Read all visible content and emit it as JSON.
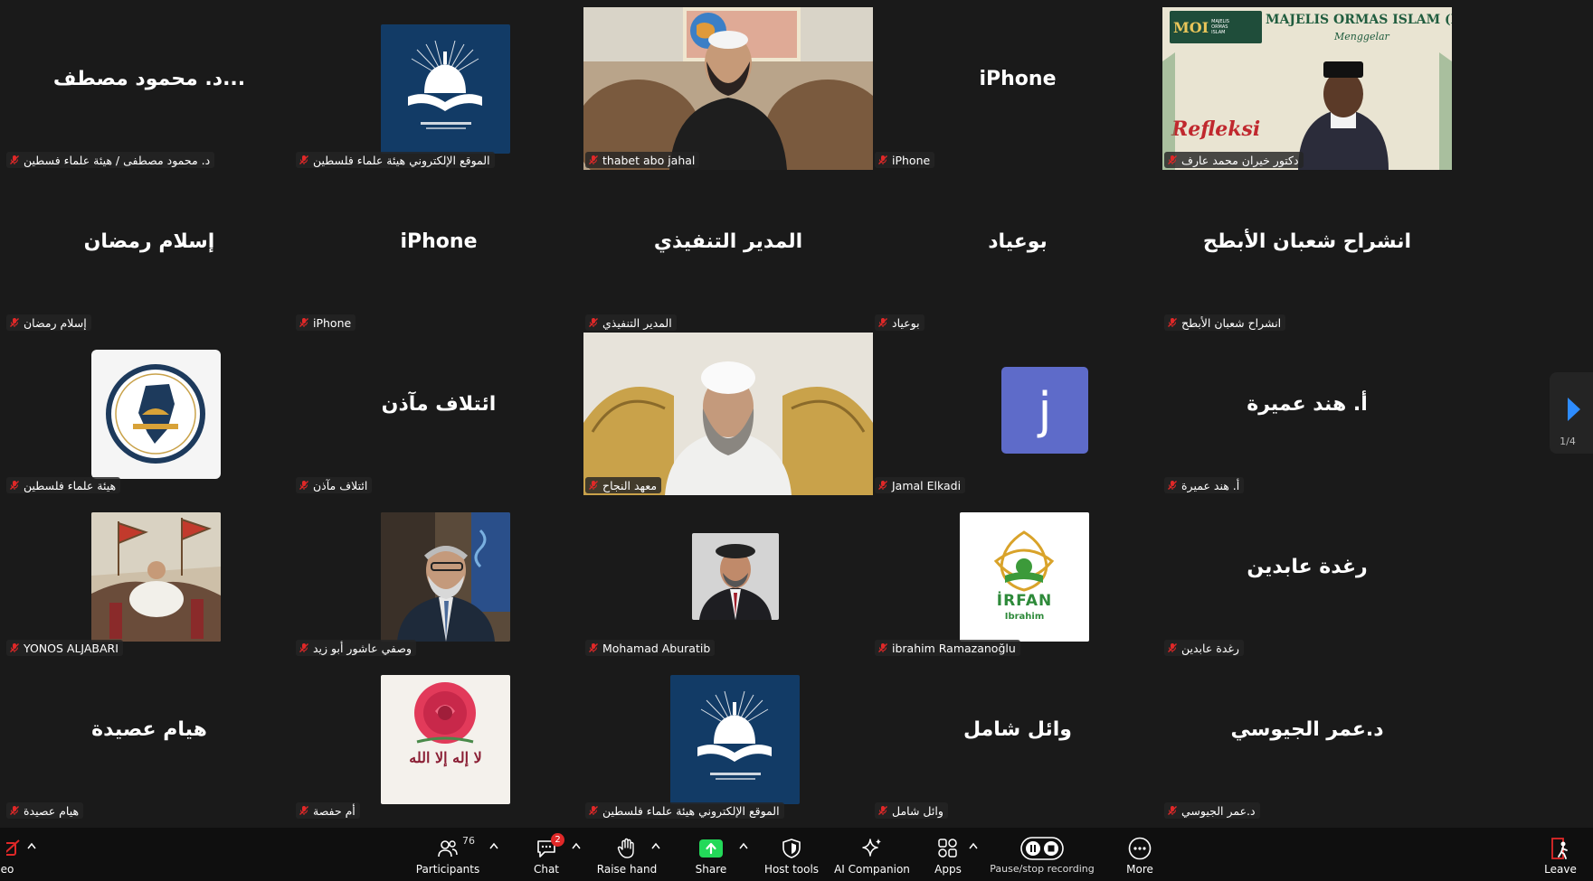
{
  "gallery": {
    "tiles": [
      {
        "big_name": "د. محمود مصطف...",
        "label": "د. محمود مصطفى / هيئة علماء فسطين"
      },
      {
        "label": "الموقع الإلكتروني هيئة علماء فلسطين"
      },
      {
        "label": "thabet abo jahal"
      },
      {
        "big_name": "iPhone",
        "label": "iPhone"
      },
      {
        "label": "دكتور خيران محمد عارف",
        "banner_title": "MAJELIS ORMAS ISLAM (MOI)",
        "banner_sub": "Menggelar",
        "banner_logo": "MOI",
        "banner_logo_sub": "MAJELIS ORMAS ISLAM",
        "banner_script": "Refleksi"
      },
      {
        "big_name": "إسلام رمضان",
        "label": "إسلام رمضان"
      },
      {
        "big_name": "iPhone",
        "label": "iPhone"
      },
      {
        "big_name": "المدير التنفيذي",
        "label": "المدير التنفيذي"
      },
      {
        "big_name": "بوعياد",
        "label": "بوعياد"
      },
      {
        "big_name": "انشراح شعبان الأبطح",
        "label": "انشراح شعبان الأبطح"
      },
      {
        "label": "هيئة علماء فلسطين"
      },
      {
        "big_name": "ائتلاف مآذن",
        "label": "ائتلاف مآذن"
      },
      {
        "label": "معهد النجاح"
      },
      {
        "avatar_letter": "j",
        "label": "Jamal Elkadi"
      },
      {
        "big_name": "أ. هند عميرة",
        "label": "أ. هند عميرة"
      },
      {
        "label": "YONOS ALJABARI"
      },
      {
        "label": "وصفي عاشور أبو زيد"
      },
      {
        "label": "Mohamad Aburatib"
      },
      {
        "label": "ibrahim Ramazanoğlu",
        "logo_text": "İRFAN",
        "logo_sub": "Ibrahim"
      },
      {
        "big_name": "رغدة عابدين",
        "label": "رغدة عابدين"
      },
      {
        "big_name": "هيام عصيدة",
        "label": "هيام عصيدة"
      },
      {
        "label": "أم حفصة",
        "calligraphy": "لا إله إلا الله"
      },
      {
        "label": "الموقع الإلكتروني هيئة علماء فلسطين"
      },
      {
        "big_name": "وائل شامل",
        "label": "وائل شامل"
      },
      {
        "big_name": "د.عمر الجيوسي",
        "label": "د.عمر الجيوسي"
      }
    ]
  },
  "pagination": {
    "page": "1/4"
  },
  "toolbar": {
    "video_label_partial": "eo",
    "participants": {
      "label": "Participants",
      "count": "76"
    },
    "chat": {
      "label": "Chat",
      "badge": "2"
    },
    "raise_hand": {
      "label": "Raise hand"
    },
    "share": {
      "label": "Share"
    },
    "host_tools": {
      "label": "Host tools"
    },
    "ai_companion": {
      "label": "AI Companion"
    },
    "apps": {
      "label": "Apps"
    },
    "recording": {
      "label": "Pause/stop recording"
    },
    "more": {
      "label": "More"
    },
    "leave": {
      "label": "Leave"
    }
  },
  "colors": {
    "background": "#1a1a1a",
    "active_speaker": "#23d959",
    "share_green": "#23d959",
    "leave_red": "#e02828",
    "avatar_purple": "#5e6bc9",
    "logo_navy": "#123b66"
  }
}
